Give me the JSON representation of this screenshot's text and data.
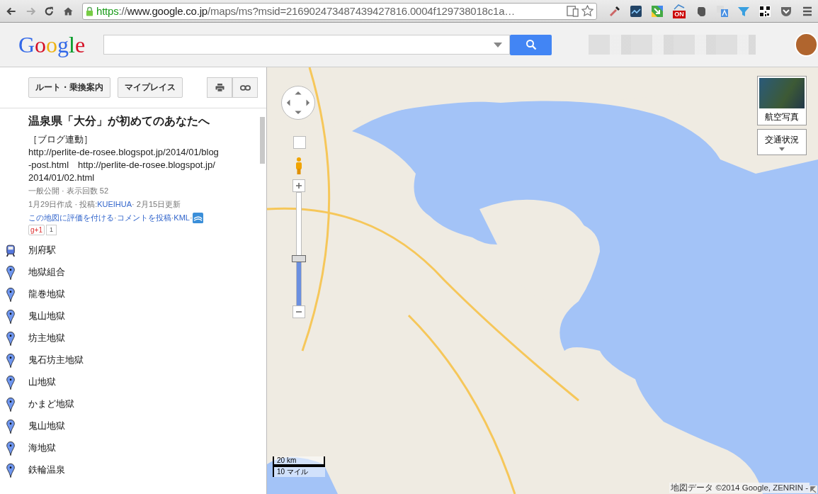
{
  "browser": {
    "url": {
      "scheme": "https",
      "separator": "://",
      "host": "www.google.co.jp",
      "path": "/maps/ms?msid=216902473487439427816.0004f129738018c1a…"
    },
    "extension_badge": "ON"
  },
  "header": {
    "logo": "Google"
  },
  "sidebar": {
    "buttons": [
      "ルート・乗換案内",
      "マイプレイス"
    ],
    "title": "温泉県「大分」が初めてのあなたへ",
    "description": [
      "［ブログ連動］",
      "http://perlite-de-rosee.blogspot.jp/2014/01/blog-post.html　http://perlite-de-rosee.blogspot.jp/2014/01/02.html"
    ],
    "meta_lines": [
      [
        {
          "kind": "text",
          "text": "一般公開 · 表示回数 52"
        }
      ],
      [
        {
          "kind": "text",
          "text": "1月29日作成 · 投稿: "
        },
        {
          "kind": "link",
          "text": "KUEIHUA"
        },
        {
          "kind": "text",
          "text": " · 2月15日更新"
        }
      ],
      [
        {
          "kind": "link",
          "text": "この地図に評価を付ける"
        },
        {
          "kind": "text",
          "text": " · "
        },
        {
          "kind": "link",
          "text": "コメントを投稿"
        },
        {
          "kind": "text",
          "text": " · "
        },
        {
          "kind": "link",
          "text": "KML"
        },
        {
          "kind": "text",
          "text": " · "
        },
        {
          "kind": "feed"
        }
      ]
    ],
    "plusone": {
      "label": "g+1",
      "count": "1"
    },
    "places": [
      {
        "name": "別府駅",
        "kind": "train"
      },
      {
        "name": "地獄組合",
        "kind": "pin"
      },
      {
        "name": "龍巻地獄",
        "kind": "pin"
      },
      {
        "name": "鬼山地獄",
        "kind": "pin"
      },
      {
        "name": "坊主地獄",
        "kind": "pin"
      },
      {
        "name": "鬼石坊主地獄",
        "kind": "pin"
      },
      {
        "name": "山地獄",
        "kind": "pin"
      },
      {
        "name": "かまど地獄",
        "kind": "pin"
      },
      {
        "name": "鬼山地獄",
        "kind": "pin"
      },
      {
        "name": "海地獄",
        "kind": "pin"
      },
      {
        "name": "鉄輪温泉",
        "kind": "pin"
      }
    ]
  },
  "map": {
    "aerial_button": "航空写真",
    "traffic_button": "交通状況",
    "zoom": {
      "level": 0.41
    },
    "scale": [
      "20 km",
      "10 マイル"
    ],
    "attribution": "地図データ ©2014 Google, ZENRIN -"
  }
}
